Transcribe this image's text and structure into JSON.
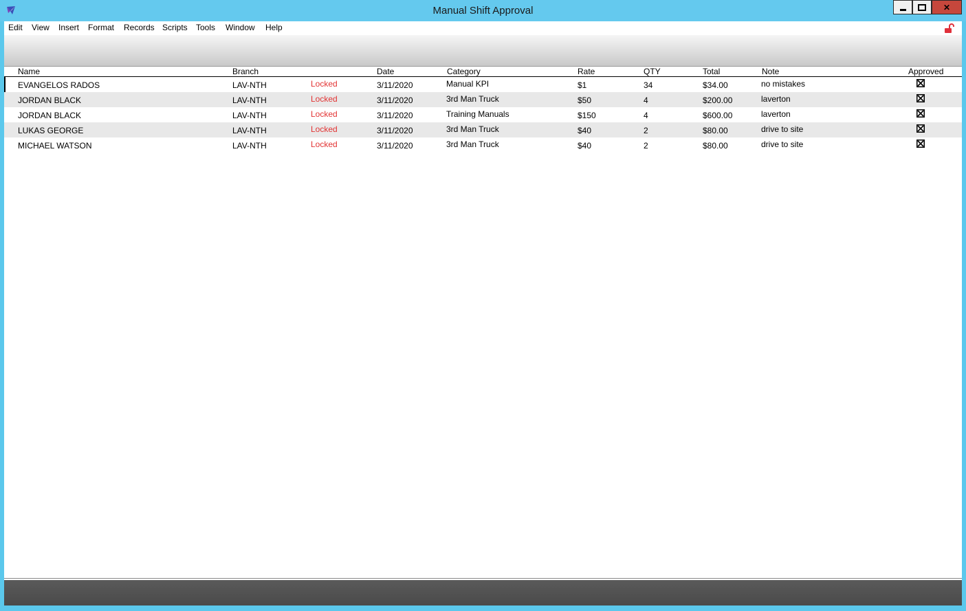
{
  "window": {
    "title": "Manual Shift Approval"
  },
  "menu": [
    "Edit",
    "View",
    "Insert",
    "Format",
    "Records",
    "Scripts",
    "Tools",
    "Window",
    "Help"
  ],
  "columns": {
    "name": "Name",
    "branch": "Branch",
    "date": "Date",
    "category": "Category",
    "rate": "Rate",
    "qty": "QTY",
    "total": "Total",
    "note": "Note",
    "approved": "Approved"
  },
  "rows": [
    {
      "name": "EVANGELOS RADOS",
      "branch": "LAV-NTH",
      "status": "Locked",
      "date": "3/11/2020",
      "category": "Manual KPI",
      "rate": "$1",
      "qty": "34",
      "total": "$34.00",
      "note": "no mistakes",
      "approved": true
    },
    {
      "name": "JORDAN BLACK",
      "branch": "LAV-NTH",
      "status": "Locked",
      "date": "3/11/2020",
      "category": "3rd Man Truck",
      "rate": "$50",
      "qty": "4",
      "total": "$200.00",
      "note": "laverton",
      "approved": true
    },
    {
      "name": "JORDAN BLACK",
      "branch": "LAV-NTH",
      "status": "Locked",
      "date": "3/11/2020",
      "category": "Training Manuals",
      "rate": "$150",
      "qty": "4",
      "total": "$600.00",
      "note": "laverton",
      "approved": true
    },
    {
      "name": "LUKAS GEORGE",
      "branch": "LAV-NTH",
      "status": "Locked",
      "date": "3/11/2020",
      "category": "3rd Man Truck",
      "rate": "$40",
      "qty": "2",
      "total": "$80.00",
      "note": "drive to site",
      "approved": true
    },
    {
      "name": "MICHAEL WATSON",
      "branch": "LAV-NTH",
      "status": "Locked",
      "date": "3/11/2020",
      "category": "3rd Man Truck",
      "rate": "$40",
      "qty": "2",
      "total": "$80.00",
      "note": "drive to site",
      "approved": true
    }
  ],
  "colors": {
    "titlebar": "#64c9ee",
    "locked": "#e23333",
    "close": "#c6473c",
    "lock_icon": "#e0303a"
  },
  "icons": {
    "app": "filemaker-icon",
    "lock": "unlocked-padlock-icon",
    "checkbox": "checked-box-icon"
  }
}
